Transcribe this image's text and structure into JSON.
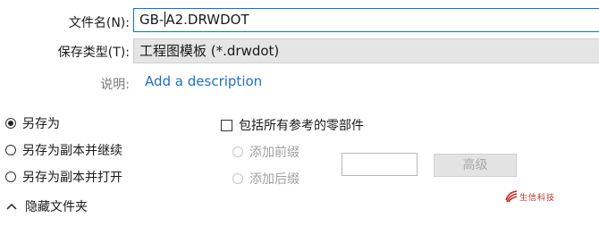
{
  "form": {
    "filename_label": "文件名(N):",
    "filename_value_before_caret": "GB-",
    "filename_value_after_caret": "A2.DRWDOT",
    "savetype_label": "保存类型(T):",
    "savetype_value": "工程图模板 (*.drwdot)",
    "description_label": "说明:",
    "description_link": "Add a description"
  },
  "options": {
    "save_as": "另存为",
    "save_as_copy_continue": "另存为副本并继续",
    "save_as_copy_open": "另存为副本并打开",
    "selected": "另存为",
    "include_refs": "包括所有参考的零部件",
    "add_prefix": "添加前缀",
    "add_suffix": "添加后缀",
    "advanced": "高级"
  },
  "footer": {
    "hide_folders": "隐藏文件夹"
  },
  "watermark": {
    "text": "生信科技"
  }
}
